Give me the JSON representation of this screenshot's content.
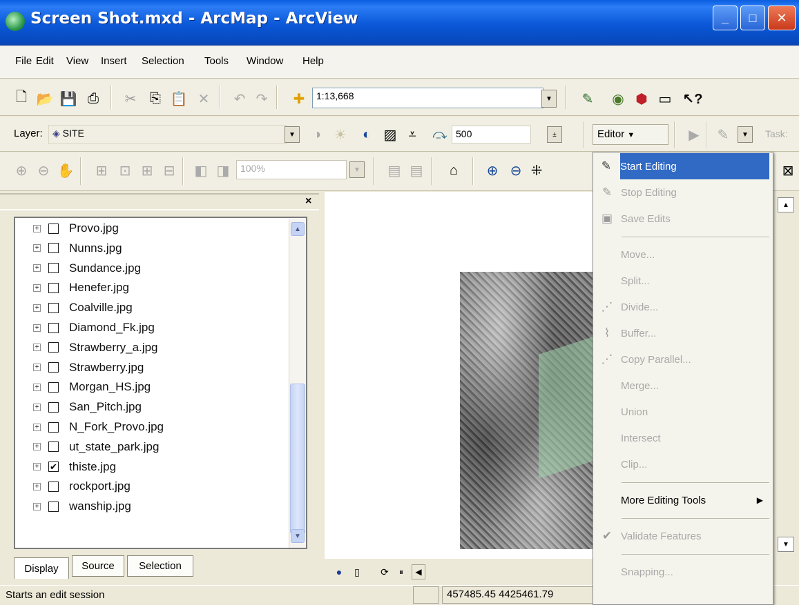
{
  "window": {
    "title": "Screen Shot.mxd - ArcMap - ArcView",
    "controls": [
      "minimize",
      "maximize",
      "close"
    ]
  },
  "menu": [
    "File",
    "Edit",
    "View",
    "Insert",
    "Selection",
    "Tools",
    "Window",
    "Help"
  ],
  "standard_toolbar": {
    "scale": "1:13,668"
  },
  "georef_toolbar": {
    "layer_label": "Layer:",
    "layer_value": "SITE",
    "value": "500"
  },
  "editor_toolbar": {
    "editor_label": "Editor",
    "task_label": "Task:"
  },
  "layout_toolbar": {
    "zoom_percent": "100%"
  },
  "toc": {
    "layers": [
      {
        "name": "Provo.jpg",
        "checked": false
      },
      {
        "name": "Nunns.jpg",
        "checked": false
      },
      {
        "name": "Sundance.jpg",
        "checked": false
      },
      {
        "name": "Henefer.jpg",
        "checked": false
      },
      {
        "name": "Coalville.jpg",
        "checked": false
      },
      {
        "name": "Diamond_Fk.jpg",
        "checked": false
      },
      {
        "name": "Strawberry_a.jpg",
        "checked": false
      },
      {
        "name": "Strawberry.jpg",
        "checked": false
      },
      {
        "name": "Morgan_HS.jpg",
        "checked": false
      },
      {
        "name": "San_Pitch.jpg",
        "checked": false
      },
      {
        "name": "N_Fork_Provo.jpg",
        "checked": false
      },
      {
        "name": "ut_state_park.jpg",
        "checked": false
      },
      {
        "name": "thiste.jpg",
        "checked": true
      },
      {
        "name": "rockport.jpg",
        "checked": false
      },
      {
        "name": "wanship.jpg",
        "checked": false
      }
    ],
    "tabs": [
      "Display",
      "Source",
      "Selection"
    ],
    "close_label": "×"
  },
  "editor_menu": {
    "items": [
      {
        "label": "Start Editing",
        "icon": "start-editing-icon",
        "glyph": "✎",
        "enabled": true,
        "highlight": true
      },
      {
        "label": "Stop Editing",
        "icon": "stop-editing-icon",
        "glyph": "✎",
        "enabled": false
      },
      {
        "label": "Save Edits",
        "icon": "save-edits-icon",
        "glyph": "▣",
        "enabled": false
      },
      {
        "separator": true
      },
      {
        "label": "Move...",
        "enabled": false
      },
      {
        "label": "Split...",
        "enabled": false
      },
      {
        "label": "Divide...",
        "icon": "divide-icon",
        "glyph": "⋰",
        "enabled": false
      },
      {
        "label": "Buffer...",
        "icon": "buffer-icon",
        "glyph": "⌇",
        "enabled": false
      },
      {
        "label": "Copy Parallel...",
        "icon": "copy-parallel-icon",
        "glyph": "⋰",
        "enabled": false
      },
      {
        "label": "Merge...",
        "enabled": false
      },
      {
        "label": "Union",
        "enabled": false
      },
      {
        "label": "Intersect",
        "enabled": false
      },
      {
        "label": "Clip...",
        "enabled": false
      },
      {
        "separator": true
      },
      {
        "label": "More Editing Tools",
        "enabled": true,
        "submenu": true
      },
      {
        "separator": true
      },
      {
        "label": "Validate Features",
        "icon": "validate-icon",
        "glyph": "✔",
        "enabled": false
      },
      {
        "separator": true
      },
      {
        "label": "Snapping...",
        "enabled": false
      }
    ]
  },
  "status": {
    "message": "Starts an edit session",
    "coordinates": "457485.45  4425461.79"
  }
}
